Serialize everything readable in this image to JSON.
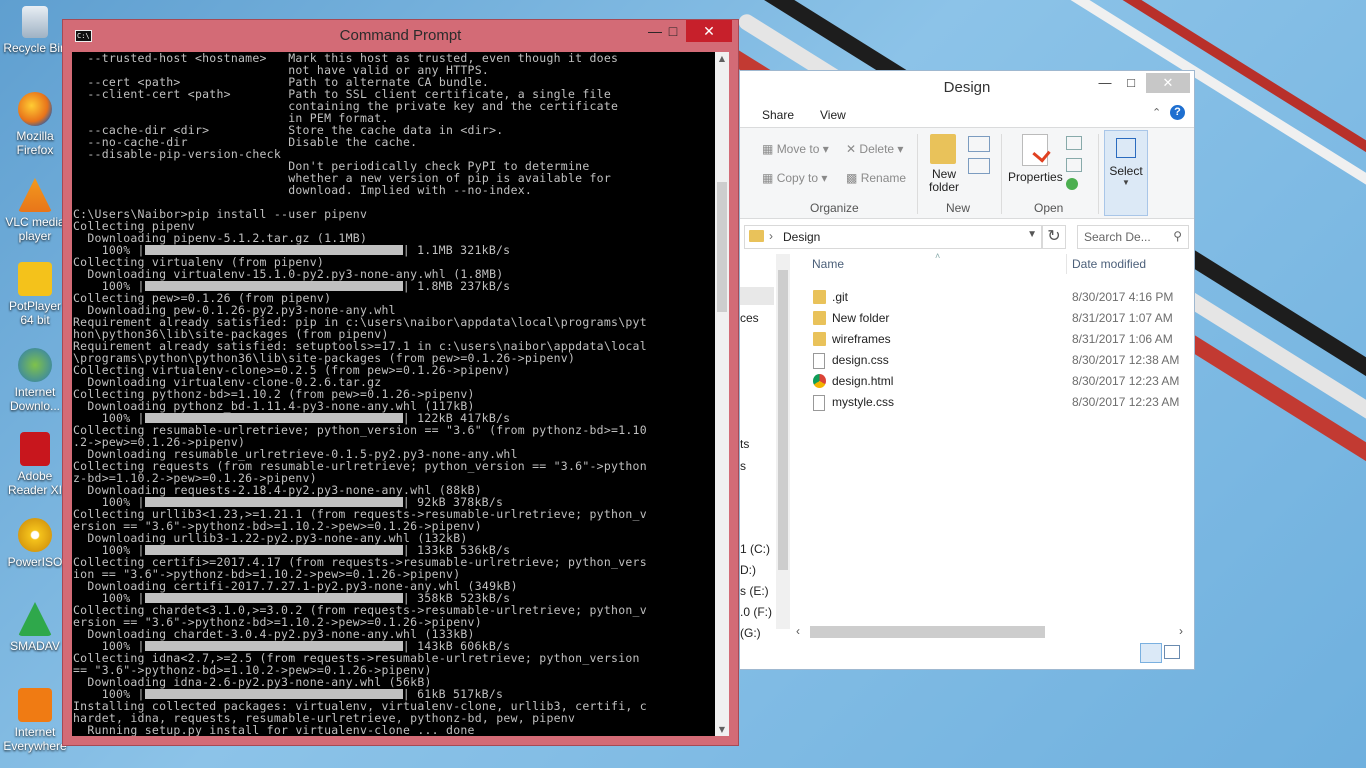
{
  "desktop": {
    "icons": [
      {
        "label": "Recycle Bin",
        "icon": "recycle-bin-icon"
      },
      {
        "label": "Mozilla Firefox",
        "icon": "firefox-icon"
      },
      {
        "label": "VLC media player",
        "icon": "vlc-icon"
      },
      {
        "label": "PotPlayer 64 bit",
        "icon": "potplayer-icon"
      },
      {
        "label": "Internet Downlo...",
        "icon": "idm-icon"
      },
      {
        "label": "Adobe Reader XI",
        "icon": "adobe-reader-icon"
      },
      {
        "label": "PowerISO",
        "icon": "poweriso-icon"
      },
      {
        "label": "SMADAV",
        "icon": "smadav-icon"
      },
      {
        "label": "Internet Everywhere",
        "icon": "internet-everywhere-icon"
      }
    ]
  },
  "cmd": {
    "title": "Command Prompt",
    "lines": [
      "  --trusted-host <hostname>   Mark this host as trusted, even though it does",
      "                              not have valid or any HTTPS.",
      "  --cert <path>               Path to alternate CA bundle.",
      "  --client-cert <path>        Path to SSL client certificate, a single file",
      "                              containing the private key and the certificate",
      "                              in PEM format.",
      "  --cache-dir <dir>           Store the cache data in <dir>.",
      "  --no-cache-dir              Disable the cache.",
      "  --disable-pip-version-check",
      "                              Don't periodically check PyPI to determine",
      "                              whether a new version of pip is available for",
      "                              download. Implied with --no-index.",
      "",
      "C:\\Users\\Naibor>pip install --user pipenv",
      "Collecting pipenv",
      "  Downloading pipenv-5.1.2.tar.gz (1.1MB)",
      "    100% |[BAR]| 1.1MB 321kB/s",
      "Collecting virtualenv (from pipenv)",
      "  Downloading virtualenv-15.1.0-py2.py3-none-any.whl (1.8MB)",
      "    100% |[BAR]| 1.8MB 237kB/s",
      "Collecting pew>=0.1.26 (from pipenv)",
      "  Downloading pew-0.1.26-py2.py3-none-any.whl",
      "Requirement already satisfied: pip in c:\\users\\naibor\\appdata\\local\\programs\\pyt",
      "hon\\python36\\lib\\site-packages (from pipenv)",
      "Requirement already satisfied: setuptools>=17.1 in c:\\users\\naibor\\appdata\\local",
      "\\programs\\python\\python36\\lib\\site-packages (from pew>=0.1.26->pipenv)",
      "Collecting virtualenv-clone>=0.2.5 (from pew>=0.1.26->pipenv)",
      "  Downloading virtualenv-clone-0.2.6.tar.gz",
      "Collecting pythonz-bd>=1.10.2 (from pew>=0.1.26->pipenv)",
      "  Downloading pythonz_bd-1.11.4-py3-none-any.whl (117kB)",
      "    100% |[BAR]| 122kB 417kB/s",
      "Collecting resumable-urlretrieve; python_version == \"3.6\" (from pythonz-bd>=1.10",
      ".2->pew>=0.1.26->pipenv)",
      "  Downloading resumable_urlretrieve-0.1.5-py2.py3-none-any.whl",
      "Collecting requests (from resumable-urlretrieve; python_version == \"3.6\"->python",
      "z-bd>=1.10.2->pew>=0.1.26->pipenv)",
      "  Downloading requests-2.18.4-py2.py3-none-any.whl (88kB)",
      "    100% |[BAR]| 92kB 378kB/s",
      "Collecting urllib3<1.23,>=1.21.1 (from requests->resumable-urlretrieve; python_v",
      "ersion == \"3.6\"->pythonz-bd>=1.10.2->pew>=0.1.26->pipenv)",
      "  Downloading urllib3-1.22-py2.py3-none-any.whl (132kB)",
      "    100% |[BAR]| 133kB 536kB/s",
      "Collecting certifi>=2017.4.17 (from requests->resumable-urlretrieve; python_vers",
      "ion == \"3.6\"->pythonz-bd>=1.10.2->pew>=0.1.26->pipenv)",
      "  Downloading certifi-2017.7.27.1-py2.py3-none-any.whl (349kB)",
      "    100% |[BAR]| 358kB 523kB/s",
      "Collecting chardet<3.1.0,>=3.0.2 (from requests->resumable-urlretrieve; python_v",
      "ersion == \"3.6\"->pythonz-bd>=1.10.2->pew>=0.1.26->pipenv)",
      "  Downloading chardet-3.0.4-py2.py3-none-any.whl (133kB)",
      "    100% |[BAR]| 143kB 606kB/s",
      "Collecting idna<2.7,>=2.5 (from requests->resumable-urlretrieve; python_version",
      "== \"3.6\"->pythonz-bd>=1.10.2->pew>=0.1.26->pipenv)",
      "  Downloading idna-2.6-py2.py3-none-any.whl (56kB)",
      "    100% |[BAR]| 61kB 517kB/s",
      "Installing collected packages: virtualenv, virtualenv-clone, urllib3, certifi, c",
      "hardet, idna, requests, resumable-urlretrieve, pythonz-bd, pew, pipenv",
      "  Running setup.py install for virtualenv-clone ... done"
    ]
  },
  "explorer": {
    "title": "Design",
    "tabs": [
      "Share",
      "View"
    ],
    "ribbon": {
      "move_to": "Move to",
      "copy_to": "Copy to",
      "delete": "Delete",
      "rename": "Rename",
      "new_folder": "New folder",
      "properties": "Properties",
      "select": "Select",
      "groups": [
        "Organize",
        "New",
        "Open"
      ]
    },
    "address": "Design",
    "search_placeholder": "Search De...",
    "columns": {
      "name": "Name",
      "date": "Date modified"
    },
    "files": [
      {
        "name": ".git",
        "date": "8/30/2017 4:16 PM",
        "type": "folder"
      },
      {
        "name": "New folder",
        "date": "8/31/2017 1:07 AM",
        "type": "folder"
      },
      {
        "name": "wireframes",
        "date": "8/31/2017 1:06 AM",
        "type": "folder"
      },
      {
        "name": "design.css",
        "date": "8/30/2017 12:38 AM",
        "type": "css"
      },
      {
        "name": "design.html",
        "date": "8/30/2017 12:23 AM",
        "type": "chrome"
      },
      {
        "name": "mystyle.css",
        "date": "8/30/2017 12:23 AM",
        "type": "css"
      }
    ],
    "nav_fragments": [
      "ces",
      "ts",
      "s",
      "1 (C:)",
      "D:)",
      "s (E:)",
      ".0 (F:)",
      "(G:)"
    ]
  },
  "colors": {
    "cmd_frame": "#d36b76",
    "close_red": "#c7202b",
    "folder_yellow": "#e9c25a"
  }
}
